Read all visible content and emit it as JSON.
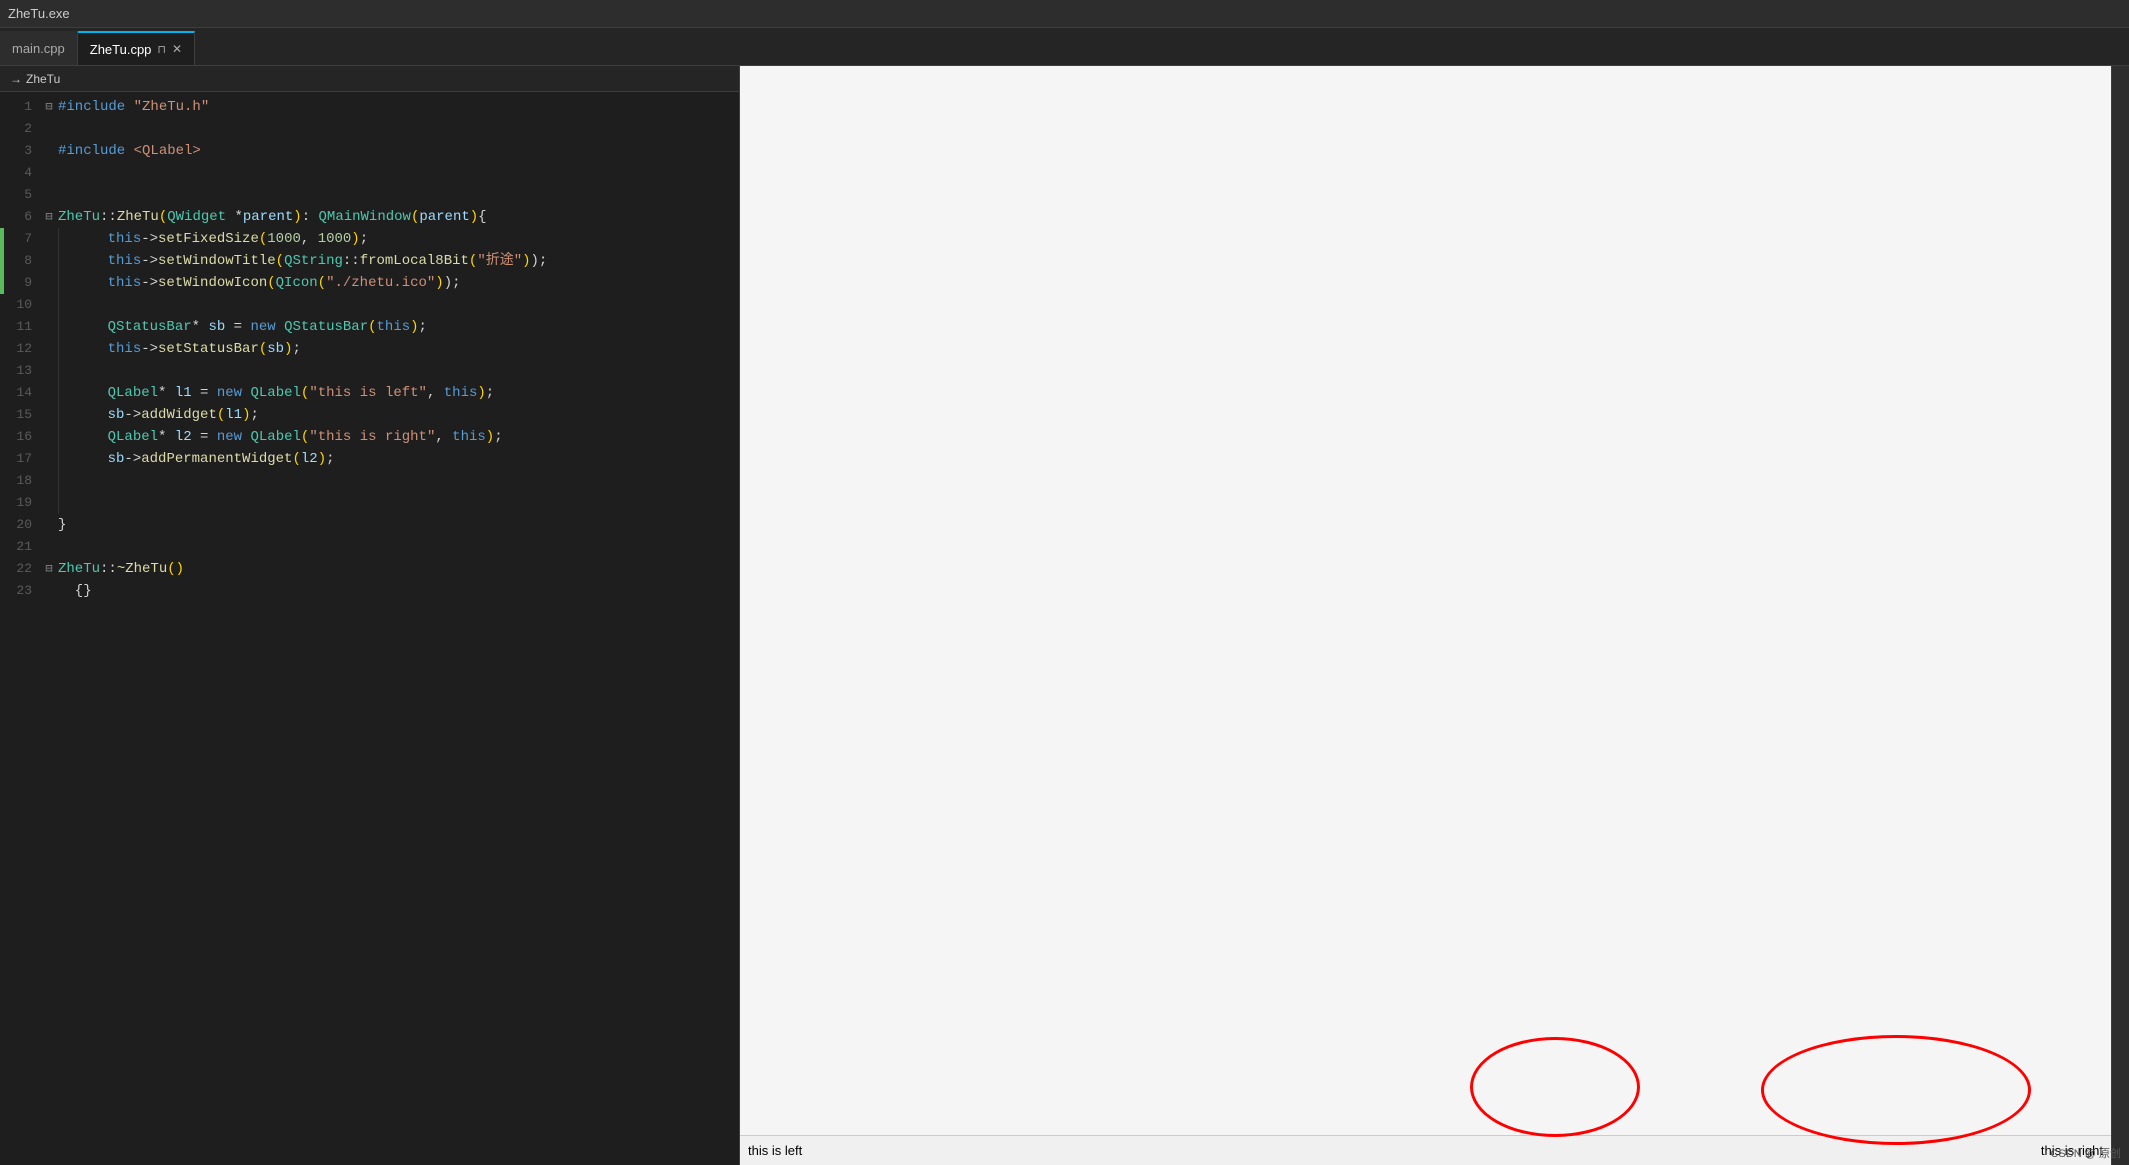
{
  "topbar": {
    "title": "ZheTu.exe"
  },
  "tabs": [
    {
      "id": "main-cpp",
      "label": "main.cpp",
      "active": false,
      "pinned": false
    },
    {
      "id": "zhe-tu-cpp",
      "label": "ZheTu.cpp",
      "active": true,
      "pinned": true
    }
  ],
  "breadcrumb": {
    "arrow": "→",
    "item": "ZheTu"
  },
  "code": {
    "lines": [
      {
        "num": 1,
        "fold": "⊟",
        "indent": 0,
        "content": "#include \"ZheTu.h\"",
        "type": "include"
      },
      {
        "num": 2,
        "fold": "",
        "indent": 0,
        "content": "",
        "type": "empty"
      },
      {
        "num": 3,
        "fold": "",
        "indent": 0,
        "content": "#include <QLabel>",
        "type": "include2"
      },
      {
        "num": 4,
        "fold": "",
        "indent": 0,
        "content": "",
        "type": "empty"
      },
      {
        "num": 5,
        "fold": "",
        "indent": 0,
        "content": "",
        "type": "empty"
      },
      {
        "num": 6,
        "fold": "⊟",
        "indent": 0,
        "content": "ZheTu::ZheTu(QWidget *parent): QMainWindow(parent){",
        "type": "constructor"
      },
      {
        "num": 7,
        "fold": "",
        "indent": 1,
        "content": "this->setFixedSize(1000, 1000);",
        "type": "statement"
      },
      {
        "num": 8,
        "fold": "",
        "indent": 1,
        "content": "this->setWindowTitle(QString::fromLocal8Bit(\"折途\"));",
        "type": "statement"
      },
      {
        "num": 9,
        "fold": "",
        "indent": 1,
        "content": "this->setWindowIcon(QIcon(\"./zhetu.ico\"));",
        "type": "statement"
      },
      {
        "num": 10,
        "fold": "",
        "indent": 1,
        "content": "",
        "type": "empty"
      },
      {
        "num": 11,
        "fold": "",
        "indent": 1,
        "content": "QStatusBar* sb = new QStatusBar(this);",
        "type": "statement"
      },
      {
        "num": 12,
        "fold": "",
        "indent": 1,
        "content": "this->setStatusBar(sb);",
        "type": "statement"
      },
      {
        "num": 13,
        "fold": "",
        "indent": 1,
        "content": "",
        "type": "empty"
      },
      {
        "num": 14,
        "fold": "",
        "indent": 1,
        "content": "QLabel* l1 = new QLabel(\"this is left\", this);",
        "type": "statement"
      },
      {
        "num": 15,
        "fold": "",
        "indent": 1,
        "content": "sb->addWidget(l1);",
        "type": "statement"
      },
      {
        "num": 16,
        "fold": "",
        "indent": 1,
        "content": "QLabel* l2 = new QLabel(\"this is right\", this);",
        "type": "statement"
      },
      {
        "num": 17,
        "fold": "",
        "indent": 1,
        "content": "sb->addPermanentWidget(l2);",
        "type": "statement"
      },
      {
        "num": 18,
        "fold": "",
        "indent": 1,
        "content": "",
        "type": "empty"
      },
      {
        "num": 19,
        "fold": "",
        "indent": 1,
        "content": "",
        "type": "empty"
      },
      {
        "num": 20,
        "fold": "",
        "indent": 0,
        "content": "}",
        "type": "brace"
      },
      {
        "num": 21,
        "fold": "",
        "indent": 0,
        "content": "",
        "type": "empty"
      },
      {
        "num": 22,
        "fold": "⊟",
        "indent": 0,
        "content": "ZheTu::~ZheTu()",
        "type": "destructor"
      },
      {
        "num": 23,
        "fold": "",
        "indent": 0,
        "content": "  {}",
        "type": "empty-body"
      }
    ]
  },
  "statusbar": {
    "left_text": "this is left",
    "right_text": "this is right"
  },
  "watermark": "CSDN @ 原创"
}
